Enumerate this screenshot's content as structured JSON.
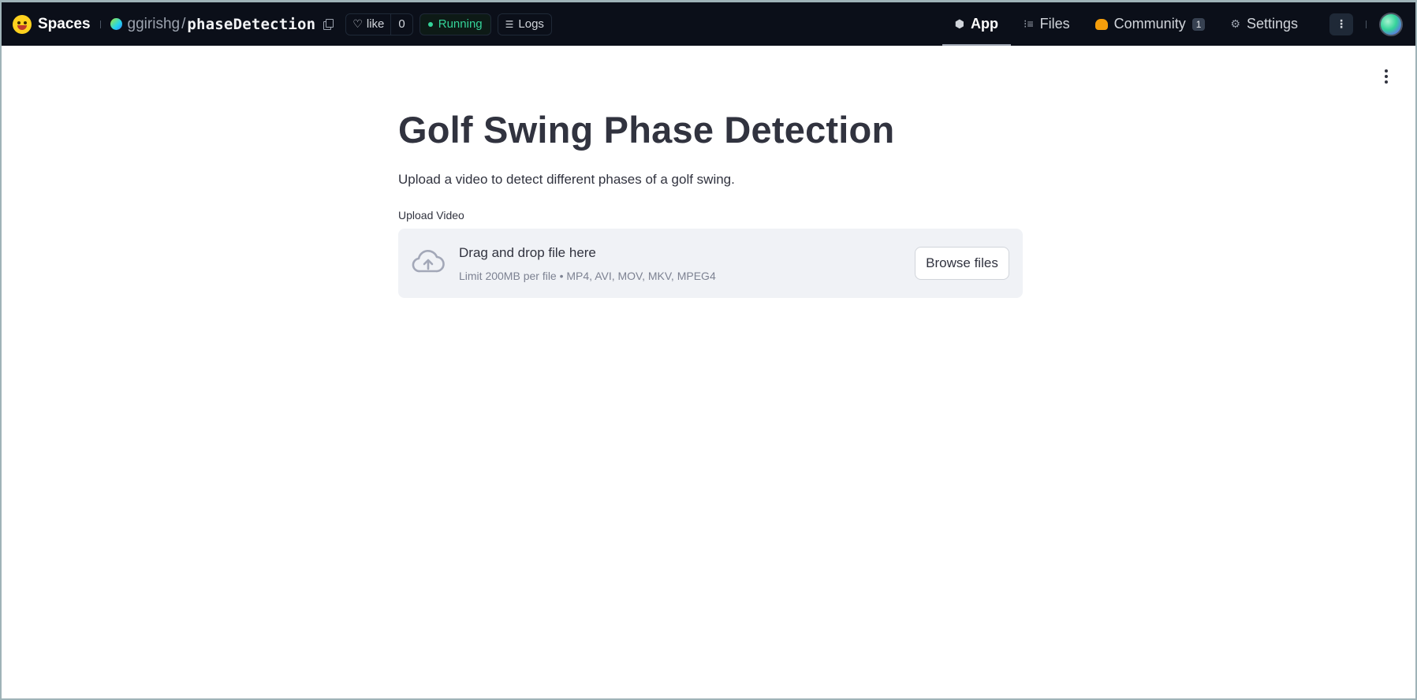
{
  "header": {
    "brand": "Spaces",
    "owner": "ggirishg",
    "separator": "/",
    "repo": "phaseDetection",
    "like_label": "like",
    "like_count": "0",
    "status": "Running",
    "logs_label": "Logs",
    "tabs": [
      {
        "label": "App",
        "icon": "cube-icon",
        "active": true
      },
      {
        "label": "Files",
        "icon": "files-icon",
        "active": false
      },
      {
        "label": "Community",
        "icon": "community-icon",
        "active": false,
        "badge": "1"
      },
      {
        "label": "Settings",
        "icon": "gear-icon",
        "active": false
      }
    ]
  },
  "main": {
    "title": "Golf Swing Phase Detection",
    "subtitle": "Upload a video to detect different phases of a golf swing.",
    "uploader": {
      "label": "Upload Video",
      "drop_text": "Drag and drop file here",
      "limit_text": "Limit 200MB per file • MP4, AVI, MOV, MKV, MPEG4",
      "browse_label": "Browse files"
    }
  },
  "colors": {
    "topbar_bg": "#0b0f19",
    "status_green": "#34d399",
    "text_dark": "#31333f",
    "dropzone_bg": "#f0f2f6"
  }
}
